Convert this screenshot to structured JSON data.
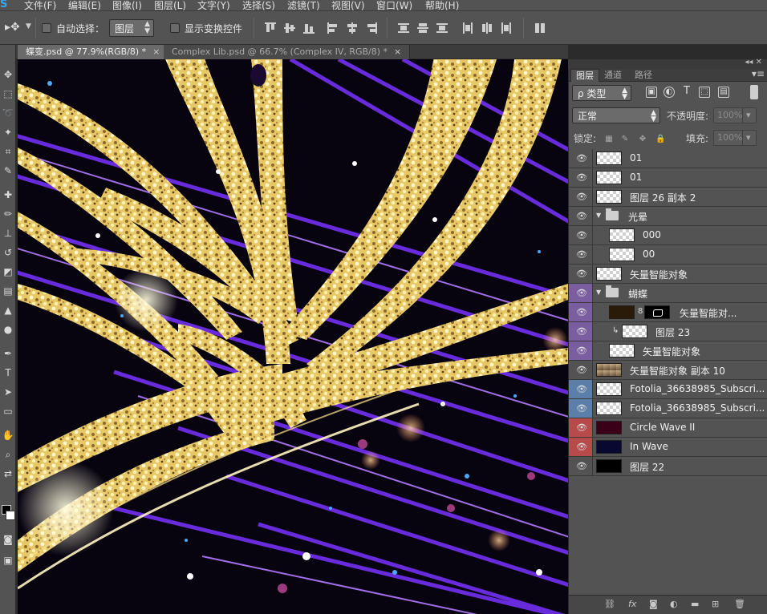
{
  "menubar": {
    "logo": "S",
    "items": [
      "文件(F)",
      "编辑(E)",
      "图像(I)",
      "图层(L)",
      "文字(Y)",
      "选择(S)",
      "滤镜(T)",
      "视图(V)",
      "窗口(W)",
      "帮助(H)"
    ]
  },
  "options": {
    "auto_select_label": "自动选择：",
    "auto_select_value": "图层",
    "show_transform_label": "显示变换控件"
  },
  "tabs": [
    {
      "label": "蝶变.psd @ 77.9%(RGB/8) *",
      "close": "×",
      "active": true
    },
    {
      "label": "Complex Lib.psd @ 66.7% (Complex IV, RGB/8) *",
      "close": "×",
      "active": false
    }
  ],
  "panel": {
    "header_icons": "◂◂ ✕",
    "tabs": [
      "图层",
      "通道",
      "路径"
    ],
    "menu_icon": "▾≡",
    "filter_kind": "ρ 类型",
    "blend_mode": "正常",
    "opacity_label": "不透明度:",
    "opacity_value": "100%",
    "lock_label": "锁定:",
    "fill_label": "填充:",
    "fill_value": "100%"
  },
  "layers": [
    {
      "name": "01",
      "kind": "layer",
      "color": "none",
      "indent": 0
    },
    {
      "name": "01",
      "kind": "layer",
      "color": "none",
      "indent": 0
    },
    {
      "name": "图层 26 副本 2",
      "kind": "layer",
      "color": "none",
      "indent": 0
    },
    {
      "name": "光晕",
      "kind": "group",
      "color": "none",
      "indent": 0
    },
    {
      "name": "000",
      "kind": "layer",
      "color": "none",
      "indent": 1
    },
    {
      "name": "00",
      "kind": "layer",
      "color": "none",
      "indent": 1
    },
    {
      "name": "矢量智能对象",
      "kind": "smart",
      "color": "none",
      "indent": 0
    },
    {
      "name": "蝴蝶",
      "kind": "group",
      "color": "purple",
      "indent": 0
    },
    {
      "name": "矢量智能对...",
      "kind": "masked",
      "color": "purple",
      "indent": 1
    },
    {
      "name": "图层 23",
      "kind": "clipped",
      "color": "purple",
      "indent": 1
    },
    {
      "name": "矢量智能对象",
      "kind": "layer",
      "color": "purple",
      "indent": 1
    },
    {
      "name": "矢量智能对象 副本 10",
      "kind": "layer",
      "color": "none",
      "indent": 0
    },
    {
      "name": "Fotolia_36638985_Subscri...",
      "kind": "layer",
      "color": "blue",
      "indent": 0
    },
    {
      "name": "Fotolia_36638985_Subscri...",
      "kind": "layer",
      "color": "blue",
      "indent": 0
    },
    {
      "name": "Circle Wave II",
      "kind": "layer",
      "color": "red",
      "indent": 0
    },
    {
      "name": "In Wave",
      "kind": "layer",
      "color": "red",
      "indent": 0
    },
    {
      "name": "图层 22",
      "kind": "layer",
      "color": "none",
      "indent": 0
    }
  ],
  "footer_icons": [
    "link-icon",
    "fx-icon",
    "mask-icon",
    "adjustment-icon",
    "folder-icon",
    "new-layer-icon",
    "trash-icon"
  ],
  "colors": {
    "panel_bg": "#535353",
    "purple_tag": "#7b5ea0",
    "blue_tag": "#5b7fa8",
    "red_tag": "#b74a4a",
    "ps_blue": "#31a8ff"
  }
}
